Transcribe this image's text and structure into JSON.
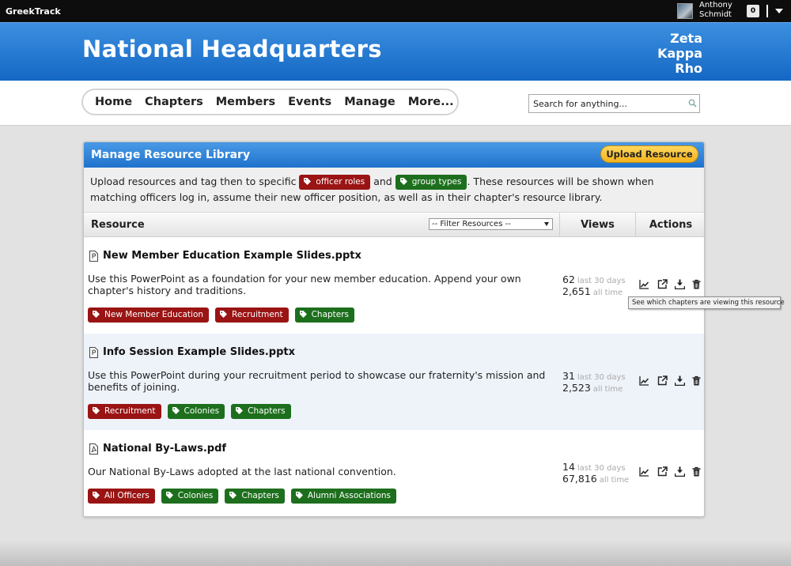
{
  "topbar": {
    "brand": "GreekTrack",
    "user_first": "Anthony",
    "user_last": "Schmidt",
    "notifications": "0"
  },
  "header": {
    "title": "National Headquarters",
    "org_line1": "Zeta",
    "org_line2": "Kappa",
    "org_line3": "Rho"
  },
  "nav": {
    "items": [
      "Home",
      "Chapters",
      "Members",
      "Events",
      "Manage",
      "More..."
    ]
  },
  "search": {
    "placeholder": "Search for anything..."
  },
  "panel": {
    "title": "Manage Resource Library",
    "upload_label": "Upload Resource",
    "intro_1": "Upload resources and tag then to specific ",
    "intro_tag_1": "officer roles",
    "intro_2": " and ",
    "intro_tag_2": "group types",
    "intro_3": ". These resources will be shown when matching officers log in, assume their new officer position, as well as in their chapter's resource library.",
    "col_resource": "Resource",
    "filter_label": "-- Filter Resources --",
    "col_views": "Views",
    "col_actions": "Actions"
  },
  "resources": [
    {
      "name": "New Member Education Example Slides.pptx",
      "description": "Use this PowerPoint as a foundation for your new member education. Append your own chapter's history and traditions.",
      "views_30": "62",
      "views_30_label": "last 30 days",
      "views_all": "2,651",
      "views_all_label": "all time",
      "tags": [
        {
          "label": "New Member Education",
          "color": "#9a1414"
        },
        {
          "label": "Recruitment",
          "color": "#9a1414"
        },
        {
          "label": "Chapters",
          "color": "#1d6f1d"
        }
      ]
    },
    {
      "name": "Info Session Example Slides.pptx",
      "description": "Use this PowerPoint during your recruitment period to showcase our fraternity's mission and benefits of joining.",
      "views_30": "31",
      "views_30_label": "last 30 days",
      "views_all": "2,523",
      "views_all_label": "all time",
      "tags": [
        {
          "label": "Recruitment",
          "color": "#9a1414"
        },
        {
          "label": "Colonies",
          "color": "#1d6f1d"
        },
        {
          "label": "Chapters",
          "color": "#1d6f1d"
        }
      ]
    },
    {
      "name": "National By-Laws.pdf",
      "description": "Our National By-Laws adopted at the last national convention.",
      "views_30": "14",
      "views_30_label": "last 30 days",
      "views_all": "67,816",
      "views_all_label": "all time",
      "tags": [
        {
          "label": "All Officers",
          "color": "#9a1414"
        },
        {
          "label": "Colonies",
          "color": "#1d6f1d"
        },
        {
          "label": "Chapters",
          "color": "#1d6f1d"
        },
        {
          "label": "Alumni Associations",
          "color": "#1d6f1d"
        }
      ]
    }
  ],
  "tooltip": "See which chapters are viewing this resource",
  "colors": {
    "header_blue": "#1f72cc",
    "tag_red": "#9a1414",
    "tag_green": "#1d6f1d",
    "button_yellow": "#f3b21b"
  },
  "icons": {
    "action": [
      "chart-icon",
      "external-link-icon",
      "download-icon",
      "trash-icon"
    ],
    "tag": "tag-icon",
    "file": "file-icon",
    "search": "search-icon"
  }
}
